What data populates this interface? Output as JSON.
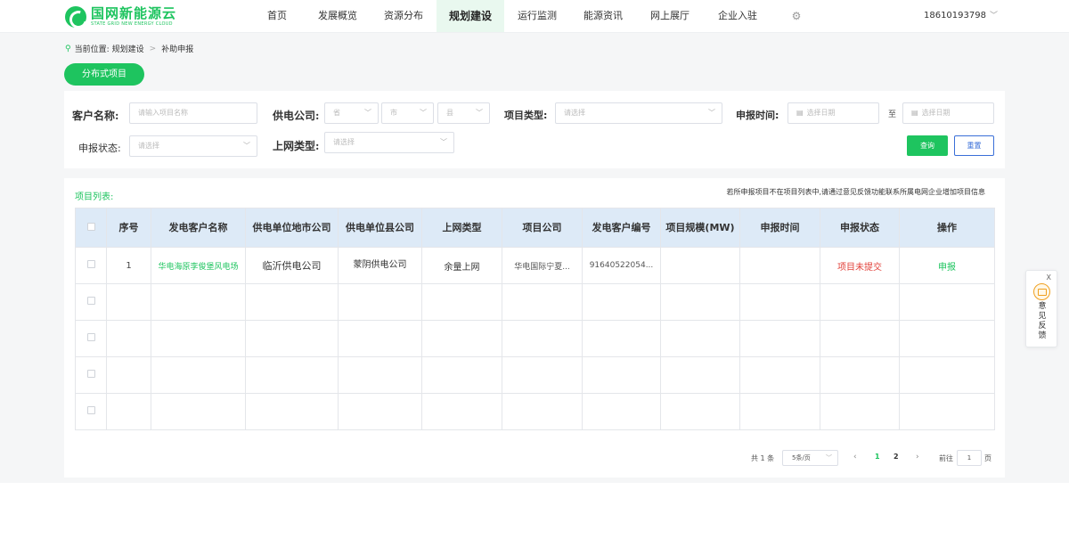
{
  "header": {
    "logo_cn": "国网新能源云",
    "logo_en": "STATE GRID NEW ENERGY CLOUD",
    "nav": [
      {
        "label": "首页",
        "active": false
      },
      {
        "label": "发展概览",
        "active": false
      },
      {
        "label": "资源分布",
        "active": false
      },
      {
        "label": "规划建设",
        "active": true
      },
      {
        "label": "运行监测",
        "active": false
      },
      {
        "label": "能源资讯",
        "active": false
      },
      {
        "label": "网上展厅",
        "active": false
      },
      {
        "label": "企业入驻",
        "active": false
      }
    ],
    "user": "18610193798"
  },
  "breadcrumb": {
    "prefix": "当前位置:",
    "level1": "规划建设",
    "level2": "补助申报"
  },
  "tab_label": "分布式项目",
  "filters": {
    "customer_label": "客户名称:",
    "customer_placeholder": "请输入项目名称",
    "supply_label": "供电公司:",
    "province_placeholder": "省",
    "city_placeholder": "市",
    "county_placeholder": "县",
    "project_type_label": "项目类型:",
    "select_placeholder": "请选择",
    "report_time_label": "申报时间:",
    "date_placeholder": "选择日期",
    "to_label": "至",
    "status_label": "申报状态:",
    "grid_type_label": "上网类型:",
    "search_button": "查询",
    "reset_button": "重置"
  },
  "list": {
    "title": "项目列表:",
    "note": "若所申报项目不在项目列表中,请通过意见反馈功能联系所属电网企业增加项目信息",
    "columns": [
      "序号",
      "发电客户名称",
      "供电单位地市公司",
      "供电单位县公司",
      "上网类型",
      "项目公司",
      "发电客户编号",
      "项目规模(MW)",
      "申报时间",
      "申报状态",
      "操作"
    ],
    "rows": [
      {
        "index": "1",
        "customer": "华电海原李俊堡风电场",
        "city_company": "临沂供电公司",
        "county_company": "蒙阴供电公司",
        "grid_type": "余量上网",
        "project_company": "华电国际宁夏...",
        "customer_no": "91640522054...",
        "scale": "",
        "report_time": "",
        "status": "项目未提交",
        "action": "申报"
      }
    ],
    "empty_rows": 4
  },
  "pagination": {
    "total": "共 1 条",
    "page_size": "5条/页",
    "pages": [
      "1",
      "2"
    ],
    "current": "1",
    "goto_label": "前往",
    "goto_value": "1",
    "goto_suffix": "页"
  },
  "feedback": {
    "close": "X",
    "label": "意见反馈"
  },
  "colors": {
    "brand": "#1ec45f",
    "danger": "#e2413a",
    "link_blue": "#3a6fd8",
    "header_bg": "#ddeaf7"
  }
}
